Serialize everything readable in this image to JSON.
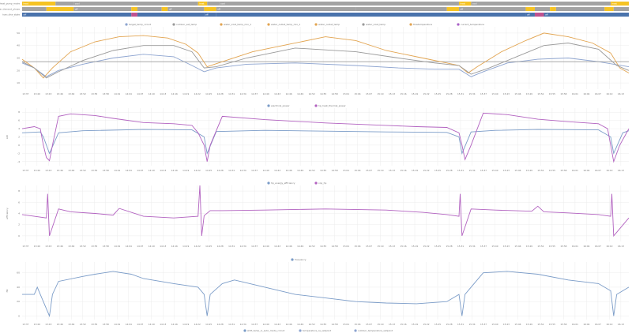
{
  "colors": {
    "state_gray": "#a3a3a3",
    "state_yellow": "#f5c324",
    "state_blue": "#4a73ac",
    "state_pink": "#c0528f",
    "grid": "#ececec",
    "axis_text": "#777777",
    "blue": "#8da4d0",
    "gray": "#9a9a9a",
    "orange": "#e2a450",
    "pink": "#a960c6",
    "purple": "#b262c0",
    "steel": "#7b9cc8"
  },
  "state_rows": [
    {
      "label": "hvac.heat_pump_mode",
      "segments": [
        {
          "from": 0.0,
          "to": 0.055,
          "color": "state_yellow",
          "text": "heat"
        },
        {
          "from": 0.055,
          "to": 0.085,
          "color": "state_gray",
          "text": ""
        },
        {
          "from": 0.085,
          "to": 0.29,
          "color": "state_gray",
          "text": "cool"
        },
        {
          "from": 0.29,
          "to": 0.305,
          "color": "state_yellow",
          "text": "heat"
        },
        {
          "from": 0.305,
          "to": 0.325,
          "color": "state_gray",
          "text": ""
        },
        {
          "from": 0.325,
          "to": 0.72,
          "color": "state_gray",
          "text": "cool"
        },
        {
          "from": 0.72,
          "to": 0.74,
          "color": "state_yellow",
          "text": "heat"
        },
        {
          "from": 0.74,
          "to": 0.97,
          "color": "state_gray",
          "text": "cool"
        },
        {
          "from": 0.97,
          "to": 1.0,
          "color": "state_yellow",
          "text": "heat"
        }
      ]
    },
    {
      "label": "hvac.demand_phase",
      "segments": [
        {
          "from": 0.0,
          "to": 0.04,
          "color": "state_gray",
          "text": ""
        },
        {
          "from": 0.04,
          "to": 0.085,
          "color": "state_yellow",
          "text": ""
        },
        {
          "from": 0.085,
          "to": 0.18,
          "color": "state_gray",
          "text": "off"
        },
        {
          "from": 0.18,
          "to": 0.19,
          "color": "state_yellow",
          "text": ""
        },
        {
          "from": 0.19,
          "to": 0.23,
          "color": "state_gray",
          "text": ""
        },
        {
          "from": 0.23,
          "to": 0.24,
          "color": "state_yellow",
          "text": ""
        },
        {
          "from": 0.24,
          "to": 0.3,
          "color": "state_gray",
          "text": "off"
        },
        {
          "from": 0.3,
          "to": 0.32,
          "color": "state_yellow",
          "text": ""
        },
        {
          "from": 0.32,
          "to": 0.55,
          "color": "state_gray",
          "text": "off"
        },
        {
          "from": 0.55,
          "to": 0.7,
          "color": "state_gray",
          "text": ""
        },
        {
          "from": 0.7,
          "to": 0.72,
          "color": "state_yellow",
          "text": ""
        },
        {
          "from": 0.72,
          "to": 0.83,
          "color": "state_gray",
          "text": "off"
        },
        {
          "from": 0.83,
          "to": 0.845,
          "color": "state_yellow",
          "text": ""
        },
        {
          "from": 0.845,
          "to": 0.87,
          "color": "state_gray",
          "text": ""
        },
        {
          "from": 0.87,
          "to": 0.88,
          "color": "state_yellow",
          "text": ""
        },
        {
          "from": 0.88,
          "to": 0.96,
          "color": "state_gray",
          "text": ""
        },
        {
          "from": 0.96,
          "to": 0.975,
          "color": "state_yellow",
          "text": ""
        },
        {
          "from": 0.975,
          "to": 1.0,
          "color": "state_gray",
          "text": ""
        }
      ]
    },
    {
      "label": "hvac.dhw_state",
      "segments": [
        {
          "from": 0.0,
          "to": 0.18,
          "color": "state_blue",
          "text": "off"
        },
        {
          "from": 0.18,
          "to": 0.19,
          "color": "state_pink",
          "text": ""
        },
        {
          "from": 0.19,
          "to": 0.3,
          "color": "state_blue",
          "text": ""
        },
        {
          "from": 0.3,
          "to": 0.32,
          "color": "state_blue",
          "text": "off"
        },
        {
          "from": 0.32,
          "to": 0.83,
          "color": "state_blue",
          "text": ""
        },
        {
          "from": 0.83,
          "to": 0.845,
          "color": "state_blue",
          "text": "off"
        },
        {
          "from": 0.845,
          "to": 0.86,
          "color": "state_pink",
          "text": ""
        },
        {
          "from": 0.86,
          "to": 1.0,
          "color": "state_blue",
          "text": "off"
        }
      ]
    }
  ],
  "x_ticks": [
    "13:37",
    "13:40",
    "13:43",
    "13:46",
    "13:49",
    "13:52",
    "13:55",
    "13:58",
    "14:01",
    "14:04",
    "14:07",
    "14:10",
    "14:13",
    "14:16",
    "14:19",
    "14:22",
    "14:25",
    "14:28",
    "14:31",
    "14:34",
    "14:37",
    "14:40",
    "14:43",
    "14:46",
    "14:49",
    "14:52",
    "14:55",
    "14:58",
    "15:01",
    "15:04",
    "15:07",
    "15:10",
    "15:13",
    "15:16",
    "15:19",
    "15:22",
    "15:25",
    "15:28",
    "15:31",
    "15:34",
    "15:37",
    "15:40",
    "15:43",
    "15:46",
    "15:49",
    "15:52",
    "15:55",
    "15:58",
    "16:01",
    "16:04",
    "16:07",
    "16:10",
    "16:13"
  ],
  "chart_data": [
    {
      "type": "line",
      "ylabel": "",
      "yticks": [
        "50",
        "40",
        "30",
        "20",
        "10"
      ],
      "ylim": [
        5,
        55
      ],
      "legend": [
        {
          "name": "target_temp_circuit",
          "color": "blue"
        },
        {
          "name": "outdoor_set_temp",
          "color": "gray"
        },
        {
          "name": "water_inlet_temp_mix_1",
          "color": "orange"
        },
        {
          "name": "water_outlet_temp_mix_1",
          "color": "orange"
        },
        {
          "name": "water_outlet_temp",
          "color": "orange"
        },
        {
          "name": "water_inlet_temp",
          "color": "gray"
        },
        {
          "name": "flowtemperature",
          "color": "orange"
        },
        {
          "name": "current_temperature",
          "color": "pink"
        }
      ],
      "series": [
        {
          "name": "target_temp_circuit",
          "color": "blue",
          "x": [
            0,
            0.02,
            0.04,
            0.06,
            0.1,
            0.15,
            0.2,
            0.25,
            0.28,
            0.3,
            0.32,
            0.37,
            0.45,
            0.55,
            0.62,
            0.68,
            0.72,
            0.74,
            0.76,
            0.8,
            0.85,
            0.9,
            0.95,
            1
          ],
          "y": [
            26,
            22,
            15,
            20,
            25,
            30,
            33,
            31,
            24,
            19,
            22,
            25,
            26,
            24,
            22,
            21,
            21,
            15,
            19,
            26,
            29,
            30,
            27,
            23
          ]
        },
        {
          "name": "outdoor_set_temp",
          "color": "gray",
          "x": [
            0,
            1
          ],
          "y": [
            27,
            27
          ]
        },
        {
          "name": "water_inlet_temp_mix_1",
          "color": "orange",
          "x": [
            0,
            0.02,
            0.035,
            0.05,
            0.08,
            0.12,
            0.16,
            0.2,
            0.24,
            0.27,
            0.29,
            0.305,
            0.33,
            0.38,
            0.44,
            0.5,
            0.55,
            0.6,
            0.66,
            0.7,
            0.72,
            0.735,
            0.75,
            0.79,
            0.83,
            0.86,
            0.9,
            0.94,
            0.97,
            0.985,
            1
          ],
          "y": [
            29,
            22,
            14,
            22,
            35,
            43,
            47,
            48,
            46,
            41,
            34,
            23,
            27,
            35,
            41,
            47,
            44,
            36,
            30,
            26,
            24,
            18,
            23,
            35,
            44,
            50,
            47,
            42,
            34,
            22,
            18
          ]
        },
        {
          "name": "water_outlet_temp",
          "color": "gray",
          "x": [
            0,
            0.02,
            0.04,
            0.06,
            0.1,
            0.15,
            0.2,
            0.25,
            0.28,
            0.3,
            0.32,
            0.37,
            0.45,
            0.55,
            0.62,
            0.68,
            0.72,
            0.74,
            0.77,
            0.82,
            0.86,
            0.9,
            0.95,
            0.98,
            1
          ],
          "y": [
            27,
            22,
            14,
            19,
            28,
            36,
            40,
            40,
            35,
            22,
            23,
            30,
            38,
            35,
            30,
            26,
            24,
            17,
            22,
            32,
            40,
            42,
            37,
            24,
            20
          ]
        }
      ]
    },
    {
      "type": "line",
      "ylabel": "kW",
      "yticks": [
        "8",
        "6",
        "4",
        "2",
        "0",
        "-2",
        "-4"
      ],
      "ylim": [
        -5,
        9
      ],
      "legend": [
        {
          "name": "electrical_power",
          "color": "steel"
        },
        {
          "name": "hp_heat_thermal_power",
          "color": "purple"
        }
      ],
      "series": [
        {
          "name": "electrical_power",
          "color": "steel",
          "x": [
            0,
            0.03,
            0.035,
            0.045,
            0.06,
            0.1,
            0.2,
            0.28,
            0.3,
            0.305,
            0.32,
            0.4,
            0.5,
            0.6,
            0.7,
            0.72,
            0.725,
            0.74,
            0.78,
            0.85,
            0.95,
            0.97,
            0.975,
            0.99,
            1
          ],
          "y": [
            3,
            3.2,
            2,
            -2,
            3,
            3.5,
            3.8,
            3.7,
            2,
            -2,
            3.3,
            3.6,
            3.4,
            3.2,
            3.1,
            2,
            -2,
            3.2,
            3.6,
            3.8,
            3.7,
            2,
            -2,
            3,
            3.5
          ]
        },
        {
          "name": "hp_heat_thermal_power",
          "color": "purple",
          "x": [
            0,
            0.02,
            0.03,
            0.035,
            0.04,
            0.045,
            0.05,
            0.06,
            0.08,
            0.12,
            0.15,
            0.2,
            0.25,
            0.28,
            0.29,
            0.3,
            0.305,
            0.31,
            0.33,
            0.4,
            0.5,
            0.6,
            0.65,
            0.7,
            0.72,
            0.725,
            0.73,
            0.74,
            0.76,
            0.8,
            0.85,
            0.9,
            0.95,
            0.965,
            0.97,
            0.975,
            0.985,
            1
          ],
          "y": [
            4,
            4.5,
            4,
            0,
            -3,
            -3.8,
            0,
            7,
            7.6,
            7.2,
            6.5,
            5.5,
            5.2,
            4.8,
            3,
            0,
            -4,
            0,
            7,
            6.2,
            5.4,
            4.8,
            4.5,
            4.3,
            3,
            0,
            -3.5,
            0,
            7.8,
            7.4,
            6.3,
            5.7,
            5.2,
            4,
            0,
            -4,
            0,
            4
          ]
        }
      ]
    },
    {
      "type": "line",
      "ylabel": "efficiency",
      "yticks": [
        "8",
        "6",
        "4",
        "2",
        "0"
      ],
      "ylim": [
        -1,
        9
      ],
      "legend": [
        {
          "name": "hp_energy_efficiency",
          "color": "steel"
        },
        {
          "name": "cop_hp",
          "color": "purple"
        }
      ],
      "series": [
        {
          "name": "cop_hp",
          "color": "purple",
          "x": [
            0,
            0.02,
            0.04,
            0.042,
            0.045,
            0.06,
            0.08,
            0.12,
            0.15,
            0.16,
            0.2,
            0.25,
            0.29,
            0.293,
            0.296,
            0.3,
            0.31,
            0.33,
            0.4,
            0.5,
            0.6,
            0.66,
            0.7,
            0.72,
            0.722,
            0.725,
            0.74,
            0.78,
            0.84,
            0.85,
            0.86,
            0.9,
            0.95,
            0.97,
            0.972,
            0.975,
            1
          ],
          "y": [
            3.8,
            3.5,
            3.2,
            7.5,
            0,
            4.8,
            4.3,
            4.0,
            3.7,
            4.9,
            3.5,
            3.2,
            3.5,
            9,
            0,
            3.6,
            4.5,
            4.5,
            4.6,
            4.8,
            4.6,
            4.2,
            3.8,
            3.5,
            7.5,
            0,
            4.8,
            4.6,
            4.4,
            5.3,
            4.3,
            4.1,
            3.8,
            3.5,
            7.5,
            0,
            3.2
          ]
        }
      ]
    },
    {
      "type": "line",
      "ylabel": "Hz",
      "yticks": [
        "60",
        "40",
        "20",
        "0"
      ],
      "ylim": [
        -5,
        75
      ],
      "legend": [
        {
          "name": "frequency",
          "color": "steel"
        }
      ],
      "series": [
        {
          "name": "frequency",
          "color": "steel",
          "x": [
            0,
            0.02,
            0.025,
            0.03,
            0.045,
            0.05,
            0.06,
            0.1,
            0.12,
            0.15,
            0.18,
            0.2,
            0.25,
            0.29,
            0.3,
            0.305,
            0.31,
            0.33,
            0.35,
            0.4,
            0.45,
            0.5,
            0.55,
            0.6,
            0.65,
            0.7,
            0.72,
            0.725,
            0.73,
            0.74,
            0.76,
            0.8,
            0.85,
            0.9,
            0.95,
            0.97,
            0.975,
            0.98,
            1
          ],
          "y": [
            30,
            30,
            40,
            30,
            0,
            30,
            48,
            55,
            58,
            62,
            58,
            52,
            45,
            40,
            30,
            0,
            30,
            45,
            50,
            40,
            30,
            25,
            20,
            18,
            17,
            20,
            30,
            0,
            30,
            40,
            60,
            62,
            58,
            50,
            45,
            35,
            0,
            30,
            40
          ]
        }
      ]
    }
  ],
  "bottom_legend": [
    {
      "name": "shift_temp_in_auto_mode_circuit",
      "color": "steel"
    },
    {
      "name": "temperature_os_setpoint",
      "color": "blue"
    },
    {
      "name": "outdoor_temperature_setpoint",
      "color": "blue"
    }
  ]
}
